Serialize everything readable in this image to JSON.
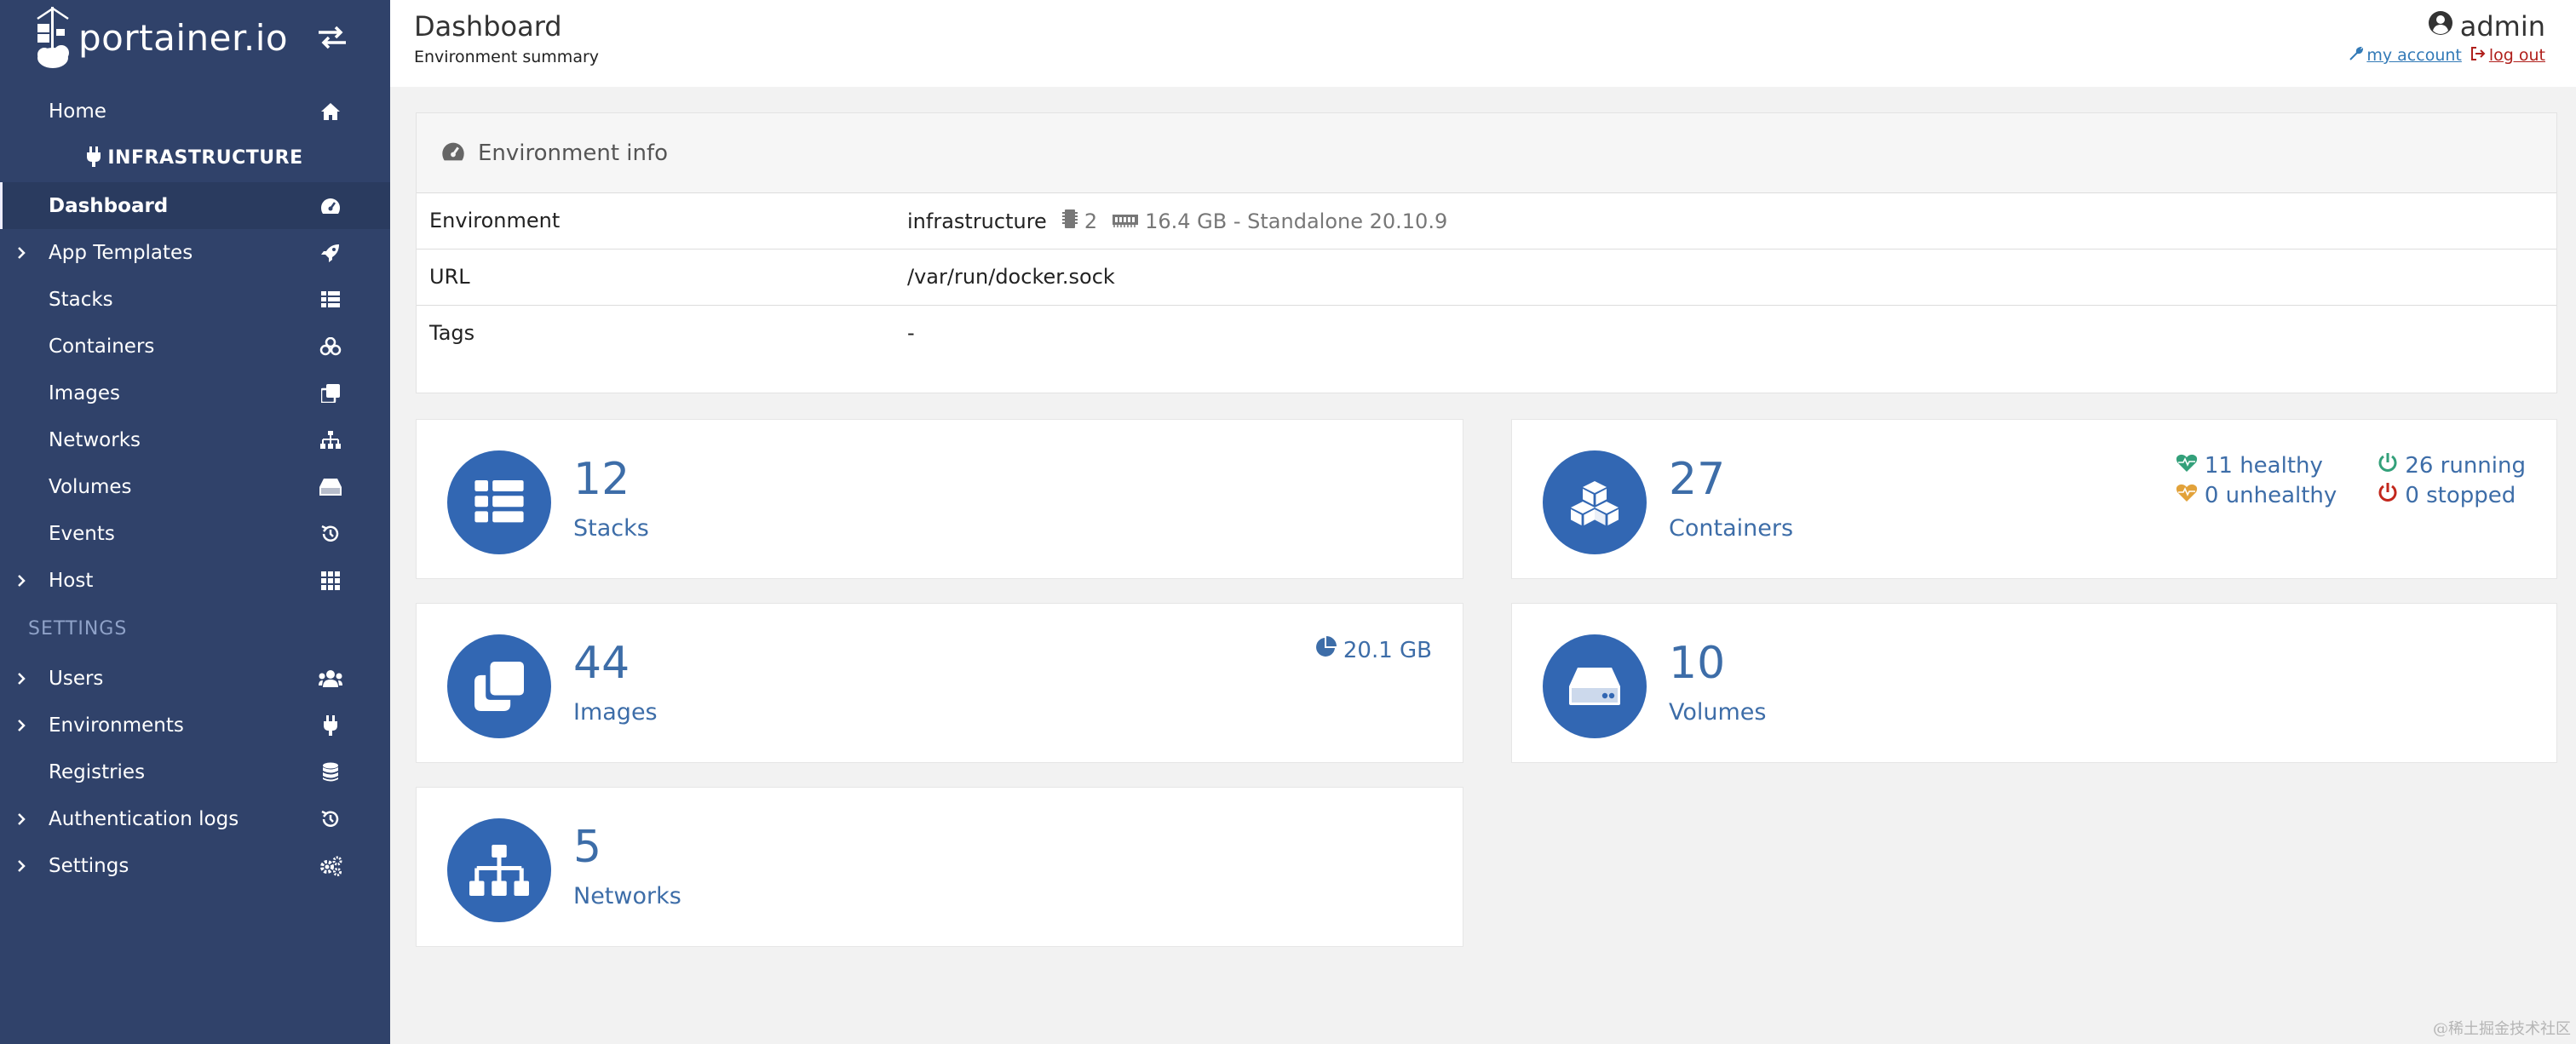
{
  "brand": {
    "logo_text": "portainer.io"
  },
  "sidebar": {
    "home": "Home",
    "environment_name": "INFRASTRUCTURE",
    "items": [
      {
        "label": "Dashboard",
        "icon": "tachometer-icon",
        "active": true,
        "expandable": false
      },
      {
        "label": "App Templates",
        "icon": "rocket-icon",
        "expandable": true
      },
      {
        "label": "Stacks",
        "icon": "th-list-icon",
        "expandable": false
      },
      {
        "label": "Containers",
        "icon": "cubes-icon",
        "expandable": false
      },
      {
        "label": "Images",
        "icon": "clone-icon",
        "expandable": false
      },
      {
        "label": "Networks",
        "icon": "sitemap-icon",
        "expandable": false
      },
      {
        "label": "Volumes",
        "icon": "hdd-icon",
        "expandable": false
      },
      {
        "label": "Events",
        "icon": "history-icon",
        "expandable": false
      },
      {
        "label": "Host",
        "icon": "th-icon",
        "expandable": true
      }
    ],
    "settings_header": "SETTINGS",
    "settings_items": [
      {
        "label": "Users",
        "icon": "users-icon",
        "expandable": true
      },
      {
        "label": "Environments",
        "icon": "plug-icon",
        "expandable": true
      },
      {
        "label": "Registries",
        "icon": "database-icon",
        "expandable": false
      },
      {
        "label": "Authentication logs",
        "icon": "history-icon",
        "expandable": true
      },
      {
        "label": "Settings",
        "icon": "cogs-icon",
        "expandable": true
      }
    ]
  },
  "header": {
    "title": "Dashboard",
    "subtitle": "Environment summary",
    "user": "admin",
    "my_account": "my account",
    "log_out": "log out"
  },
  "env_info": {
    "title": "Environment info",
    "rows": {
      "environment": {
        "key": "Environment",
        "name": "infrastructure",
        "cpu": "2",
        "memory_and_mode": "16.4 GB - Standalone 20.10.9"
      },
      "url": {
        "key": "URL",
        "value": "/var/run/docker.sock"
      },
      "tags": {
        "key": "Tags",
        "value": "-"
      }
    }
  },
  "tiles": {
    "stacks": {
      "count": "12",
      "label": "Stacks"
    },
    "containers": {
      "count": "27",
      "label": "Containers",
      "healthy": "11 healthy",
      "running": "26 running",
      "unhealthy": "0 unhealthy",
      "stopped": "0 stopped"
    },
    "images": {
      "count": "44",
      "label": "Images",
      "size": "20.1 GB"
    },
    "volumes": {
      "count": "10",
      "label": "Volumes"
    },
    "networks": {
      "count": "5",
      "label": "Networks"
    }
  },
  "colors": {
    "sidebar_bg": "#30426a",
    "accent_blue": "#3267b3",
    "stat_text": "#3d6da8",
    "healthy": "#33a07a",
    "unhealthy": "#e2a23a",
    "running": "#33a07a",
    "stopped": "#c2271c"
  },
  "watermark": "@稀土掘金技术社区"
}
